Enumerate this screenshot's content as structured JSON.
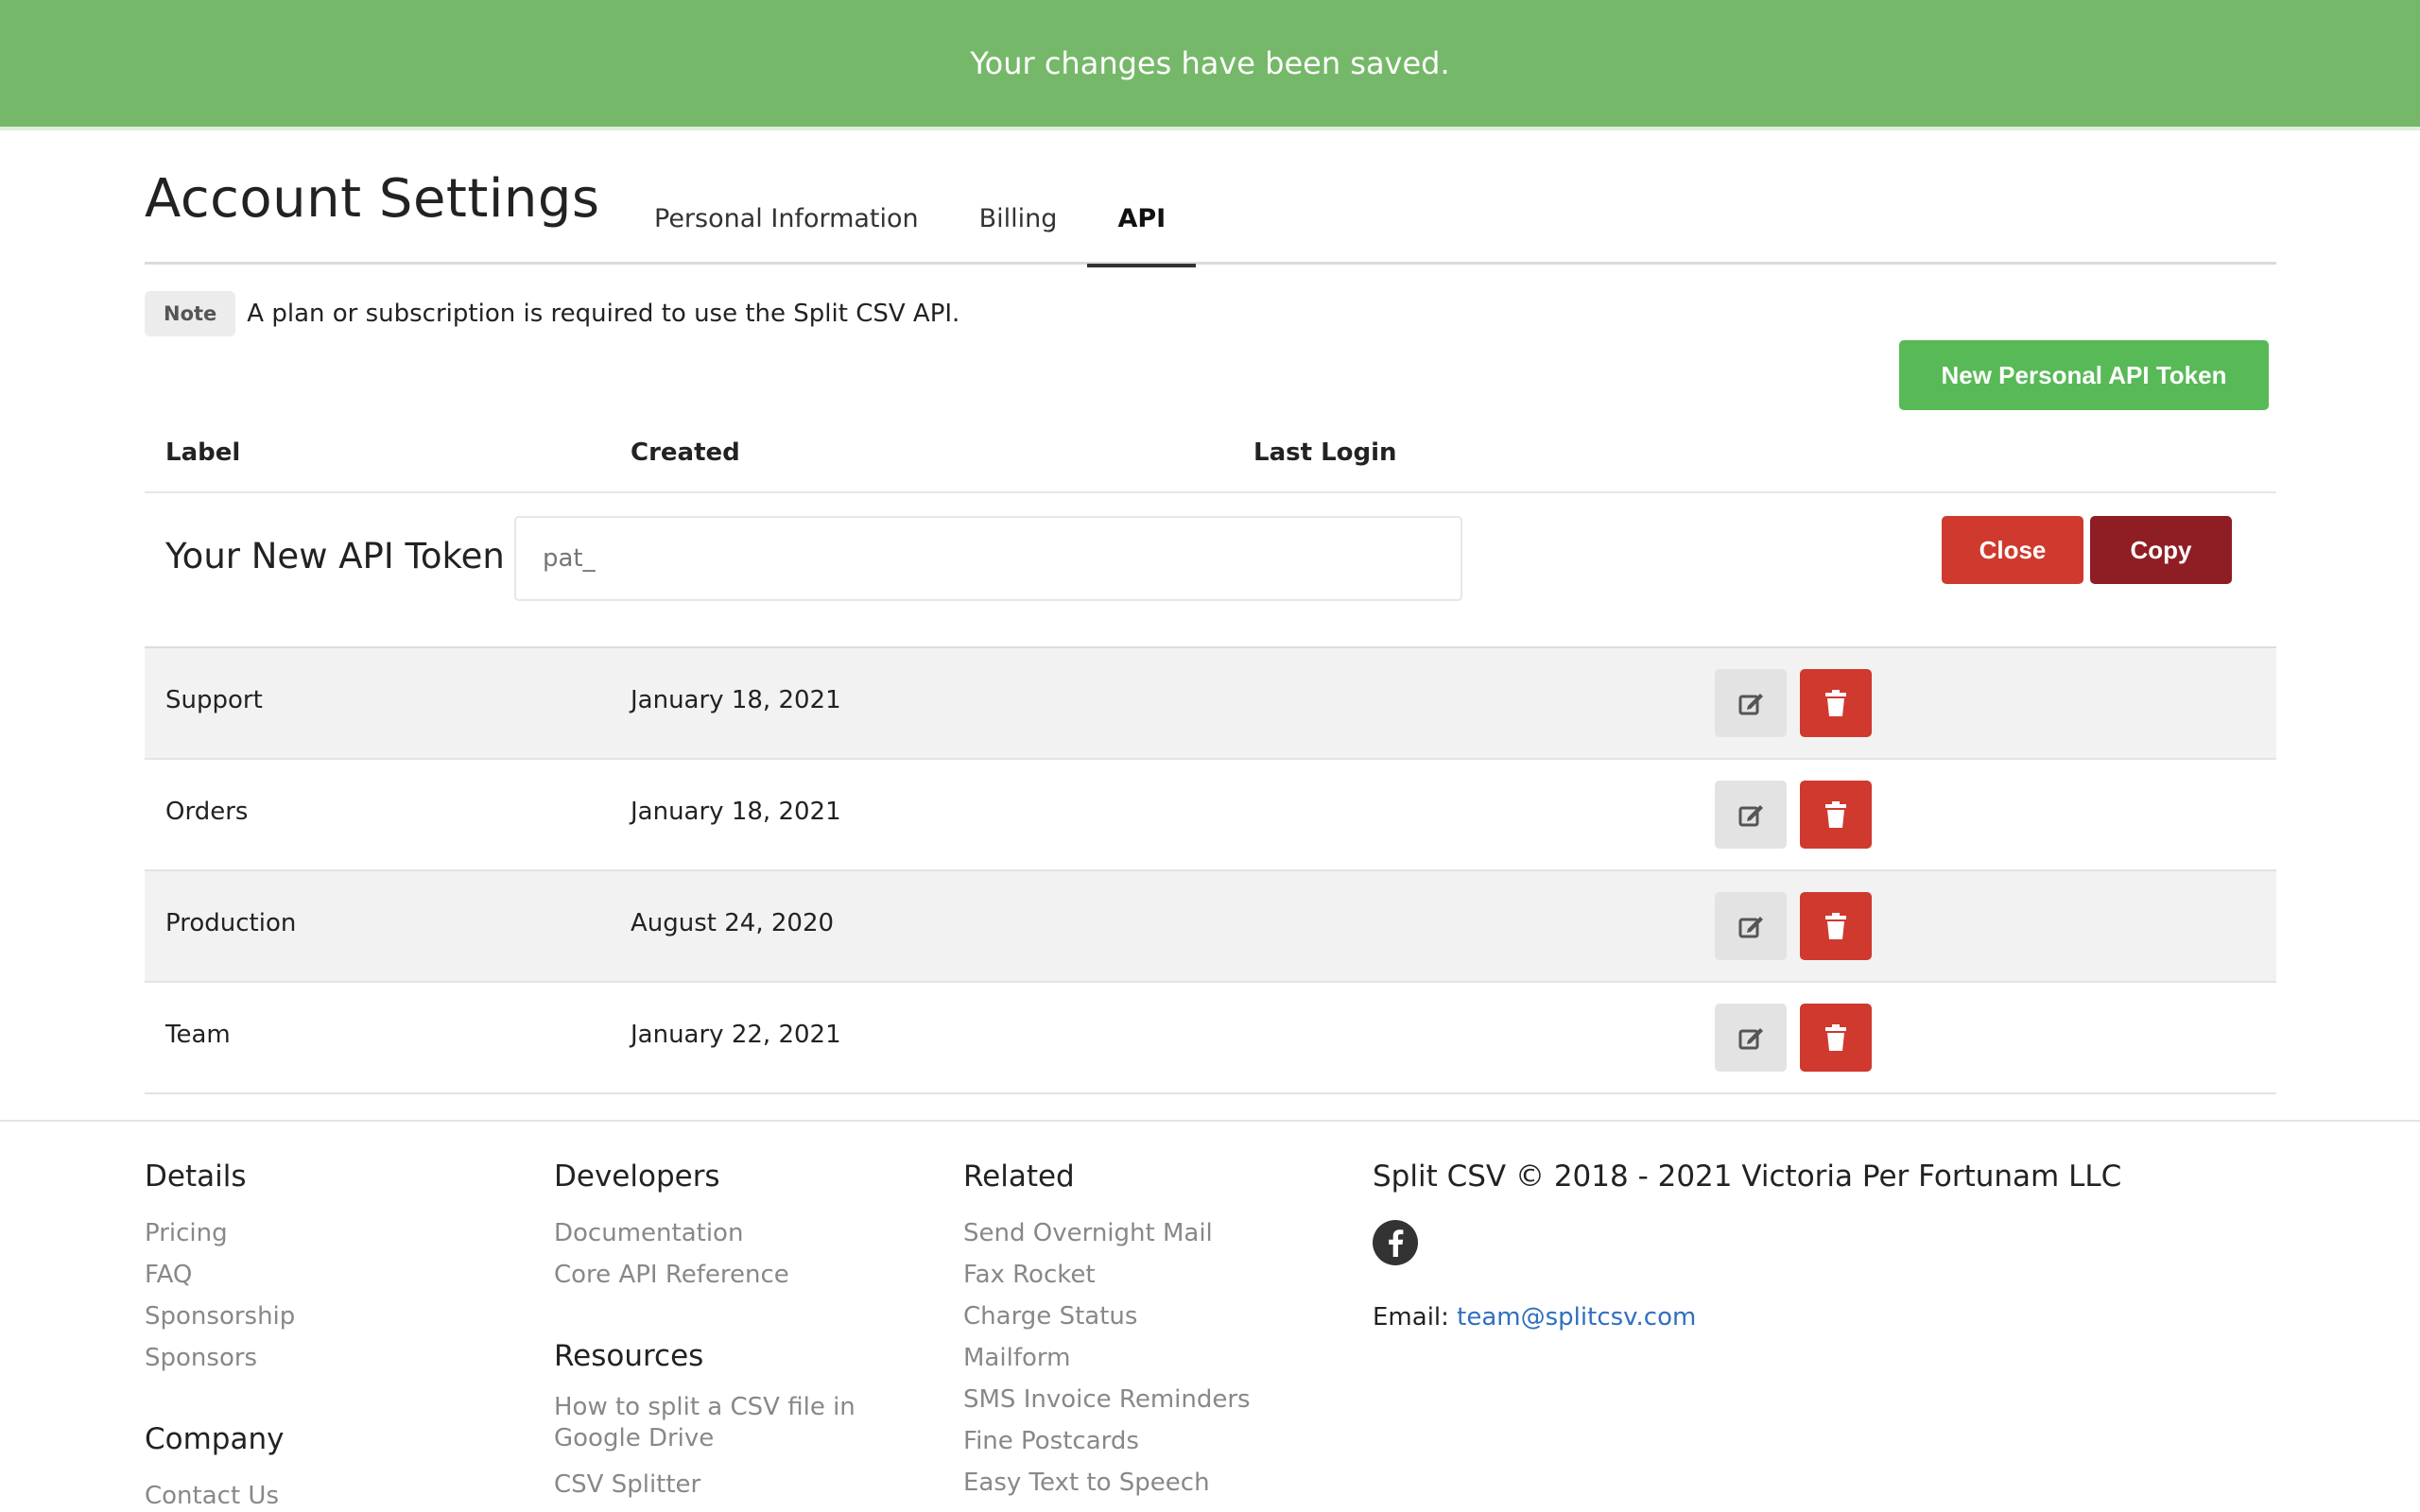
{
  "banner": {
    "message": "Your changes have been saved."
  },
  "header": {
    "title": "Account Settings",
    "tabs": [
      {
        "label": "Personal Information",
        "active": false
      },
      {
        "label": "Billing",
        "active": false
      },
      {
        "label": "API",
        "active": true
      }
    ]
  },
  "note": {
    "badge": "Note",
    "text": "A plan or subscription is required to use the Split CSV API."
  },
  "actions": {
    "new_token": "New Personal API Token"
  },
  "table": {
    "columns": {
      "label": "Label",
      "created": "Created",
      "last_login": "Last Login"
    },
    "new_token": {
      "label": "Your New API Token",
      "value": "",
      "placeholder": "pat_",
      "close": "Close",
      "copy": "Copy"
    },
    "rows": [
      {
        "label": "Support",
        "created": "January 18, 2021",
        "last_login": ""
      },
      {
        "label": "Orders",
        "created": "January 18, 2021",
        "last_login": ""
      },
      {
        "label": "Production",
        "created": "August 24, 2020",
        "last_login": ""
      },
      {
        "label": "Team",
        "created": "January 22, 2021",
        "last_login": ""
      }
    ]
  },
  "footer": {
    "details": {
      "heading": "Details",
      "links": [
        "Pricing",
        "FAQ",
        "Sponsorship",
        "Sponsors"
      ]
    },
    "company": {
      "heading": "Company",
      "links": [
        "Contact Us"
      ]
    },
    "developers": {
      "heading": "Developers",
      "links": [
        "Documentation",
        "Core API Reference"
      ]
    },
    "resources": {
      "heading": "Resources",
      "links": [
        "How to split a CSV file in Google Drive",
        "CSV Splitter"
      ]
    },
    "related": {
      "heading": "Related",
      "links": [
        "Send Overnight Mail",
        "Fax Rocket",
        "Charge Status",
        "Mailform",
        "SMS Invoice Reminders",
        "Fine Postcards",
        "Easy Text to Speech"
      ]
    },
    "copyright": "Split CSV © 2018 - 2021 Victoria Per Fortunam LLC",
    "email_label": "Email:",
    "email": "team@splitcsv.com"
  },
  "colors": {
    "banner": "#76b869",
    "primary_green": "#58b957",
    "danger": "#d0392e",
    "dark_red": "#8f1d24",
    "link_blue": "#2f6fc0"
  },
  "icons": {
    "edit": "edit-icon",
    "delete": "trash-icon",
    "social": "facebook-icon"
  }
}
